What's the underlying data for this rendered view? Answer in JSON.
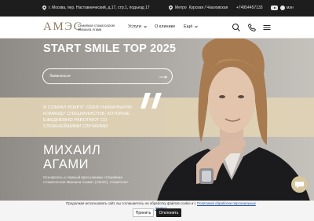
{
  "topbar": {
    "address": "г. Москва, пер. Наставнический, д.17, стр.1, подъезд 17",
    "metro_label": "Метро",
    "metro": "Курская / Чкаловская",
    "phone": "+74954457133",
    "lang": "мэн"
  },
  "header": {
    "logo": "АМЭС",
    "logo_subtitle": "Семейная стоматология Михаила Агами",
    "nav": [
      "Услуги",
      "О клинике",
      "Ещё"
    ]
  },
  "hero": {
    "title": "START SMILE TOP 2025",
    "signup_label": "Записаться",
    "quote": "Я собрал вокруг себя уникальную команду специалистов, которые ежедневно работают со сложнейшими случаями",
    "name_line1": "Михаил",
    "name_line2": "Агами",
    "bio": "Основатель и главный врач клиники «Семейная стоматология Михаила Агами» (АМЭС), стоматолог-"
  },
  "cookie": {
    "text": "Продолжая использовать сайт, вы соглашаетесь на обработку файлов cookie и с",
    "link": "Политикой обработки персональных данных",
    "accept": "Принять",
    "decline": "Отклонить"
  },
  "colors": {
    "accent": "#8a7b5f",
    "topbar_bg": "#1d1d1d",
    "band": "#e1d2b4",
    "chat": "#d6c79f"
  }
}
